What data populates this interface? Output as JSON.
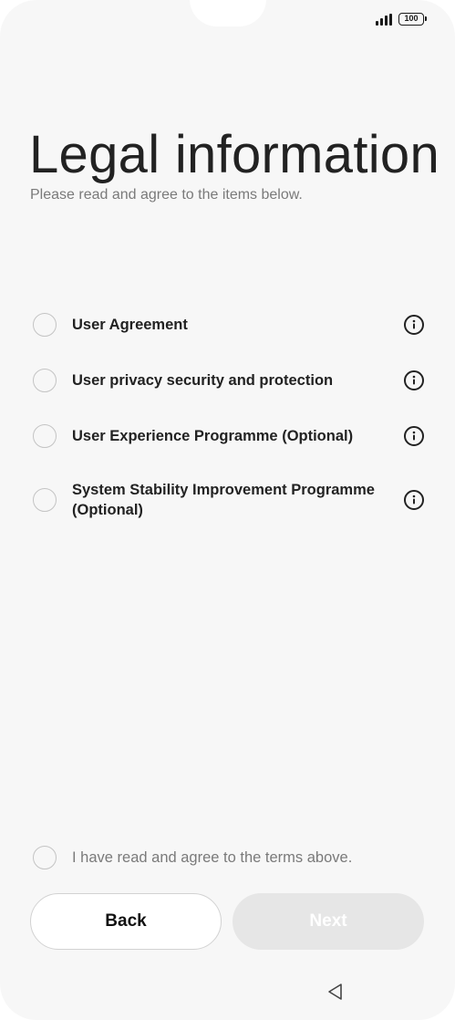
{
  "status_bar": {
    "battery": "100"
  },
  "header": {
    "title": "Legal information",
    "subtitle": "Please read and agree to the items below."
  },
  "items": [
    {
      "label": "User Agreement"
    },
    {
      "label": "User privacy security and protection"
    },
    {
      "label": "User Experience Programme (Optional)"
    },
    {
      "label": "System Stability Improvement Programme (Optional)"
    }
  ],
  "agreement": {
    "label": "I have read and agree to the terms above."
  },
  "buttons": {
    "back": "Back",
    "next": "Next"
  },
  "icons": {
    "signal": "signal-icon",
    "battery": "battery-icon",
    "info": "info-icon",
    "nav_back": "triangle-back-icon"
  }
}
